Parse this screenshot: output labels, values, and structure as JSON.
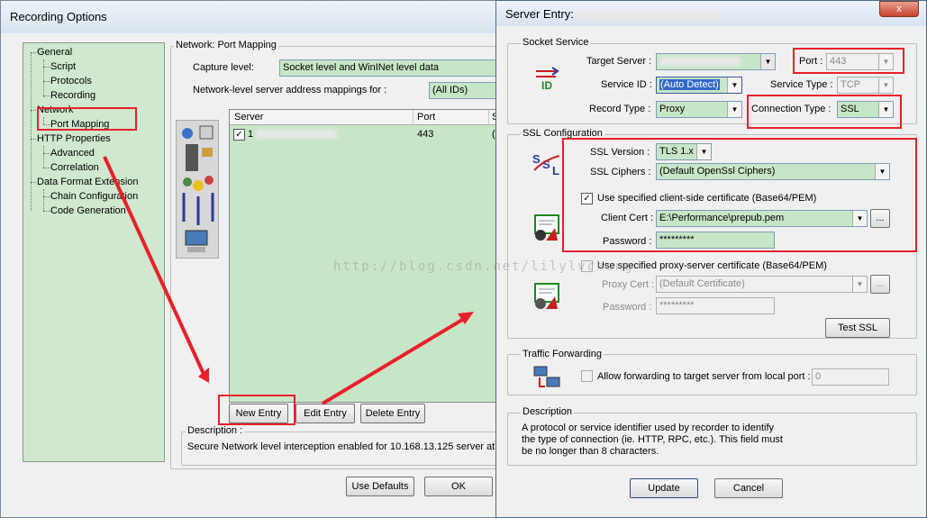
{
  "recording_options": {
    "title": "Recording Options",
    "tree": {
      "general": "General",
      "script": "Script",
      "protocols": "Protocols",
      "recording": "Recording",
      "network": "Network",
      "port_mapping": "Port Mapping",
      "http_properties": "HTTP Properties",
      "advanced": "Advanced",
      "correlation": "Correlation",
      "data_format_extension": "Data Format Extension",
      "chain_configuration": "Chain Configuration",
      "code_generation": "Code Generation"
    },
    "section_title": "Network: Port Mapping",
    "capture_level_label": "Capture level:",
    "capture_level_value": "Socket level and WinINet level data",
    "mappings_label": "Network-level server address mappings for :",
    "mappings_value": "(All IDs)",
    "table": {
      "columns": [
        "Server",
        "Port",
        "S"
      ],
      "rows": [
        {
          "server": "1",
          "port": "443",
          "s": "(A"
        }
      ]
    },
    "new_entry": "New Entry",
    "edit_entry": "Edit Entry",
    "delete_entry": "Delete Entry",
    "description_label": "Description :",
    "description_text": "Secure  Network level interception enabled for 10.168.13.125 server at p",
    "use_defaults": "Use Defaults",
    "ok": "OK"
  },
  "server_entry": {
    "title": "Server Entry:",
    "close": "x",
    "socket_service": "Socket Service",
    "target_server_label": "Target Server :",
    "port_label": "Port :",
    "port_value": "443",
    "service_id_label": "Service ID :",
    "service_id_value": "(Auto Detect)",
    "service_type_label": "Service Type :",
    "service_type_value": "TCP",
    "record_type_label": "Record Type :",
    "record_type_value": "Proxy",
    "connection_type_label": "Connection Type :",
    "connection_type_value": "SSL",
    "ssl_configuration": "SSL Configuration",
    "ssl_version_label": "SSL Version :",
    "ssl_version_value": "TLS 1.x",
    "ssl_ciphers_label": "SSL Ciphers :",
    "ssl_ciphers_value": "(Default OpenSsl Ciphers)",
    "use_client_cert_label": "Use specified client-side certificate (Base64/PEM)",
    "client_cert_label": "Client Cert :",
    "client_cert_value": "E:\\Performance\\prepub.pem",
    "password_label": "Password :",
    "password_value": "*********",
    "use_proxy_cert_label": "Use specified proxy-server certificate (Base64/PEM)",
    "proxy_cert_label": "Proxy Cert :",
    "proxy_cert_value": "(Default Certificate)",
    "proxy_password_label": "Password :",
    "proxy_password_value": "*********",
    "browse": "...",
    "test_ssl": "Test SSL",
    "traffic_forwarding": "Traffic Forwarding",
    "allow_forwarding_label": "Allow forwarding to target server from local port :",
    "forward_port_value": "0",
    "description_label": "Description",
    "description_text": "A protocol or service identifier used by recorder to identify\nthe type of connection (ie. HTTP, RPC, etc.).  This field must\nbe no longer than 8 characters.",
    "update": "Update",
    "cancel": "Cancel"
  },
  "watermark": "http://blog.csdn.net/lilylvcheng",
  "accent_colors": {
    "highlight_red": "#e8202a",
    "field_green": "#c7e6c7",
    "tree_green": "#cfe8cf"
  }
}
